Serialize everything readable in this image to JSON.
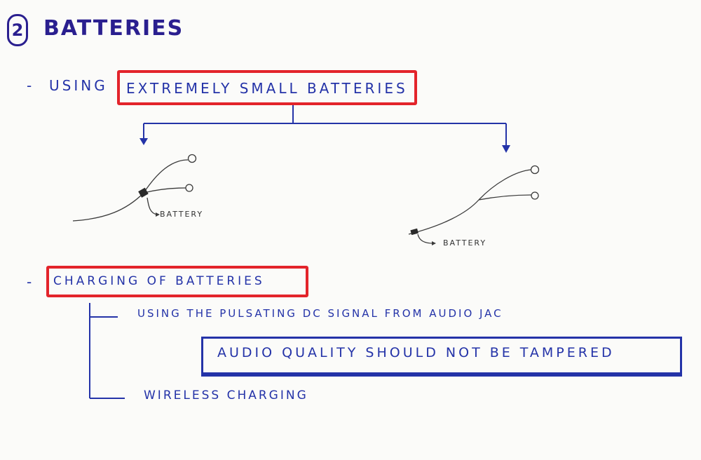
{
  "title": {
    "number": "2",
    "text": "BATTERIES"
  },
  "bullets": {
    "first_dash": "-",
    "second_dash": "-"
  },
  "line1": {
    "prefix": "USING",
    "boxed": "EXTREMELY   SMALL  BATTERIES"
  },
  "diagram": {
    "left_label": "BATTERY",
    "right_label": "BATTERY"
  },
  "section2": {
    "boxed": "CHARGING   OF   BATTERIES",
    "sub1": "USING   THE    PULSATING   DC   SIGNAL   FROM   AUDIO   JAC",
    "note": "AUDIO   QUALITY    SHOULD    NOT    BE   TAMPERED",
    "sub2": "WIRELESS   CHARGING"
  },
  "colors": {
    "ink_blue": "#2433a8",
    "title_blue": "#2a1f8f",
    "highlight_red": "#e3242b",
    "pencil": "#3a3a3a"
  }
}
